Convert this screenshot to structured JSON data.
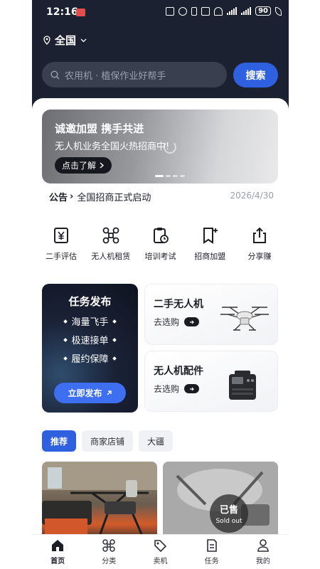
{
  "status_bar": {
    "time": "12:16",
    "battery": "90"
  },
  "location": {
    "label": "全国",
    "icon": "location-pin-icon"
  },
  "search": {
    "placeholder": "农用机 · 植保作业好帮手",
    "button_label": "搜索"
  },
  "banner": {
    "title": "诚邀加盟 携手共进",
    "subtitle": "无人机业务全国火热招商中!",
    "cta_label": "点击了解",
    "slide_count": 4,
    "active_slide": 1
  },
  "notice": {
    "label": "公告",
    "arrow": "›",
    "text": "全国招商正式启动",
    "date": "2026/4/30"
  },
  "quick_actions": [
    {
      "label": "二手评估",
      "icon": "price-tag-yen-icon"
    },
    {
      "label": "无人机租赁",
      "icon": "drone-icon"
    },
    {
      "label": "培训考试",
      "icon": "clipboard-clock-icon"
    },
    {
      "label": "招商加盟",
      "icon": "bookmark-plus-icon"
    },
    {
      "label": "分享赚",
      "icon": "share-upload-icon"
    }
  ],
  "task_card": {
    "title": "任务发布",
    "features": [
      "海量飞手",
      "极速接单",
      "履约保障"
    ],
    "button_label": "立即发布",
    "button_icon": "arrow-up-right-icon"
  },
  "product_cards": [
    {
      "title": "二手无人机",
      "link_label": "去选购",
      "image": "agricultural-drone-image"
    },
    {
      "title": "无人机配件",
      "link_label": "去选购",
      "image": "portable-power-station-image"
    }
  ],
  "tabs": [
    "推荐",
    "商家店铺",
    "大疆"
  ],
  "active_tab": "推荐",
  "listings": [
    {
      "image": "drone-listing-photo"
    },
    {
      "image": "drone-listing-photo-sold",
      "badge_cn": "已售",
      "badge_en": "Sold out"
    }
  ],
  "bottom_nav": [
    {
      "label": "首页",
      "icon": "home-icon"
    },
    {
      "label": "分类",
      "icon": "category-icon"
    },
    {
      "label": "卖机",
      "icon": "sell-tag-icon"
    },
    {
      "label": "任务",
      "icon": "task-document-icon"
    },
    {
      "label": "我的",
      "icon": "profile-icon"
    }
  ],
  "active_nav": "首页",
  "colors": {
    "header_bg": "#1c2131",
    "accent_blue": "#2e60e0",
    "text_dark": "#1d1f27",
    "muted": "#9b9ea6"
  }
}
